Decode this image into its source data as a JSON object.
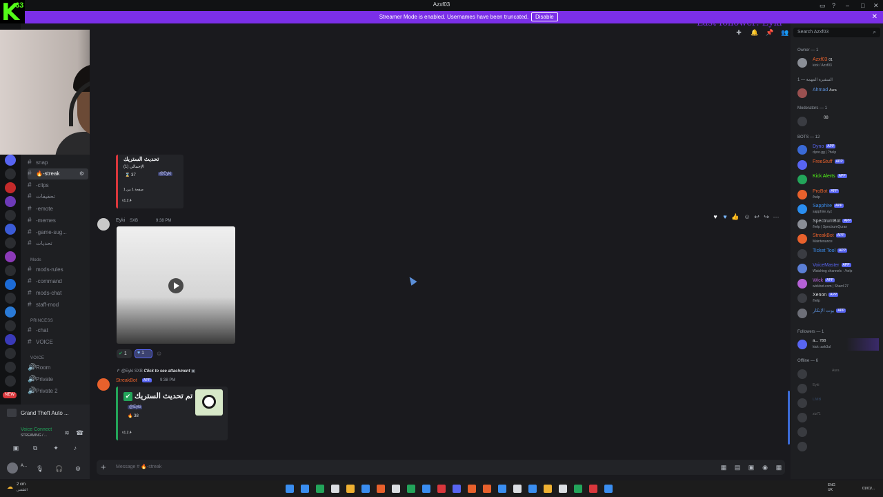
{
  "window": {
    "title": "Azxf03"
  },
  "stream": {
    "kick_number": "63",
    "last_follower": "Last follower: Eyki"
  },
  "banner": {
    "message": "Streamer Mode is enabled. Usernames have been truncated.",
    "disable_label": "Disable"
  },
  "channels": {
    "items": [
      {
        "label": "snap"
      },
      {
        "label": "-streak"
      },
      {
        "label": "-clips"
      },
      {
        "label": "تحقيقات"
      },
      {
        "label": "-emote"
      },
      {
        "label": "-memes"
      },
      {
        "label": "-game-sug..."
      },
      {
        "label": "تحديات"
      }
    ],
    "mods_category": "Mods",
    "mods_items": [
      {
        "label": "mods-rules"
      },
      {
        "label": "-command"
      },
      {
        "label": "mods-chat"
      },
      {
        "label": "staff-mod"
      }
    ],
    "princess_category": "PRINCESS",
    "princess_items": [
      {
        "label": "-chat"
      },
      {
        "label": "VOICE"
      }
    ],
    "voice_category": "VOICE",
    "voice_items": [
      {
        "label": "Room"
      },
      {
        "label": "Private"
      },
      {
        "label": "Private 2"
      }
    ],
    "new_badge": "NEW"
  },
  "user_panel": {
    "game": "Grand Theft Auto ...",
    "voice_connected": "Voice Connect",
    "voice_status": "STREAMING / ...",
    "user_initial": "A..."
  },
  "messages": {
    "embed1": {
      "title": "تحديث الستريك",
      "line1": "الإجمالي (1)",
      "count": "37",
      "mention": "@Eyki",
      "footer": "صفحة 1 من 1",
      "version": "v1.2.4"
    },
    "msg2": {
      "username": "Eyki",
      "tag": "SXB",
      "time": "9:38 PM",
      "reaction1_count": "1",
      "reaction2_count": "1"
    },
    "msg3": {
      "reply_user": "@Eyki",
      "reply_tag": "SXB",
      "reply_text": "Click to see attachment",
      "username": "StreakBot",
      "app_badge": "APP",
      "time": "9:38 PM",
      "embed_title": "تم تحديث الستريك",
      "mention": "@Eyki",
      "count": "38",
      "version": "v1.2.4"
    }
  },
  "input": {
    "placeholder": "Message # 🔥-streak"
  },
  "members": {
    "search_placeholder": "Search Azxf03",
    "owner_header": "Owner — 1",
    "owner": {
      "name": "Azxf03",
      "badge": "01",
      "status": "kick / Azxf03"
    },
    "role2_header": "السفيرة المهمة — 1",
    "role2_member": {
      "name": "Ahmad",
      "tag": "Aura"
    },
    "mods_header": "Moderators — 1",
    "mod_member": {
      "name": "08"
    },
    "bots_header": "BOTS — 12",
    "bots": [
      {
        "name": "Dyno",
        "status": "dyno.gg | ?help"
      },
      {
        "name": "FreeStuff",
        "status": ""
      },
      {
        "name": "Kick Alerts",
        "status": ""
      },
      {
        "name": "ProBot",
        "status": "/help"
      },
      {
        "name": "Sapphire",
        "status": "sapphire.xyz"
      },
      {
        "name": "SpectrumBot",
        "status": "/help | SpectrumQuran"
      },
      {
        "name": "StreakBot",
        "status": "Maintenance"
      },
      {
        "name": "Ticket Tool",
        "status": ""
      },
      {
        "name": "VoiceMaster",
        "status": "Watching channels · /help"
      },
      {
        "name": "Wick",
        "status": "wickbot.com | Shard 27"
      },
      {
        "name": "Xenon",
        "status": "/help"
      },
      {
        "name": "بوت الإنكار",
        "status": ""
      }
    ],
    "app_label": "APP",
    "followers_header": "Followers — 1",
    "follower": {
      "name": "a...",
      "tag": "7BB",
      "status": "kick: ash3ul"
    },
    "offline_header": "Offline — 6",
    "offline": [
      {
        "name": "Aura"
      },
      {
        "name": "Eyki"
      },
      {
        "name": "LMB"
      },
      {
        "name": "ziz71"
      },
      {
        "name": ""
      },
      {
        "name": ""
      }
    ]
  },
  "taskbar": {
    "weather": "2 cm",
    "weather_sub": "الطقس",
    "lang": "ENG",
    "region": "UK",
    "date": "01/01/..."
  },
  "colors": {
    "banner": "#7b2fe8",
    "kick_green": "#53fc18",
    "bot_orange": "#e8612c",
    "app_blue": "#5865f2",
    "online_green": "#23a55a"
  }
}
